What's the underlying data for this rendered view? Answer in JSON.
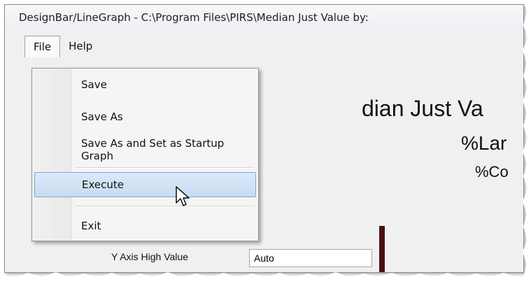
{
  "window": {
    "title": "DesignBar/LineGraph - C:\\Program Files\\PIRS\\Median Just Value by:"
  },
  "menubar": {
    "file_label": "File",
    "help_label": "Help"
  },
  "file_menu": {
    "items": [
      {
        "label": "Save"
      },
      {
        "label": "Save As"
      },
      {
        "label": "Save As and Set as Startup Graph"
      },
      {
        "label": "Execute"
      },
      {
        "label": "Exit"
      }
    ],
    "highlighted": "Execute"
  },
  "chart_preview": {
    "title": "dian Just Va",
    "subtitle1": "%Lar",
    "subtitle2": "%Co"
  },
  "form": {
    "y_axis_high_label": "Y Axis High Value",
    "y_axis_high_value": "Auto"
  },
  "colors": {
    "highlight_bg": "#c7dbf2",
    "highlight_border": "#7ea8dc",
    "bar_color": "#4a1010"
  }
}
